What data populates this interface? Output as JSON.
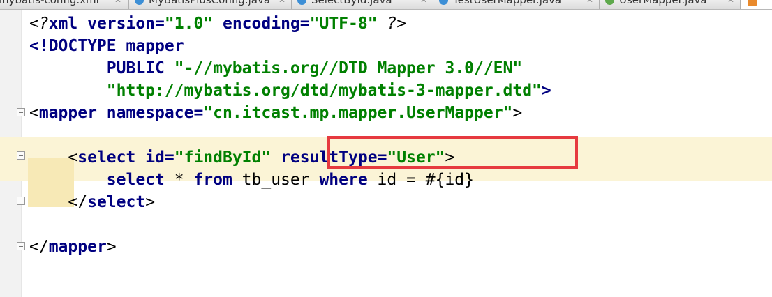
{
  "tabs": [
    {
      "label": "mybatis-config.xml",
      "icon": "xml-file-icon",
      "icon_color": "#e98a2c"
    },
    {
      "label": "MyBatisPlusConfig.java",
      "icon": "java-class-icon",
      "icon_color": "#3d8fd6"
    },
    {
      "label": "SelectById.java",
      "icon": "java-class-icon",
      "icon_color": "#3d8fd6"
    },
    {
      "label": "TestUserMapper.java",
      "icon": "java-class-icon",
      "icon_color": "#3d8fd6"
    },
    {
      "label": "UserMapper.java",
      "icon": "java-interface-icon",
      "icon_color": "#5ea94c"
    },
    {
      "label": "",
      "icon": "xml-file-icon",
      "icon_color": "#e98a2c"
    }
  ],
  "code": {
    "line1": {
      "a": "<?",
      "b": "xml",
      "c": " version",
      "d": "=",
      "e": "\"1.0\"",
      "f": " encoding",
      "g": "=",
      "h": "\"UTF-8\"",
      "i": " ?>"
    },
    "line2": {
      "a": "<!DOCTYPE ",
      "b": "mapper"
    },
    "line3": {
      "a": "        PUBLIC ",
      "b": "\"-//mybatis.org//DTD Mapper 3.0//EN\""
    },
    "line4": {
      "a": "        ",
      "b": "\"http://mybatis.org/dtd/mybatis-3-mapper.dtd\"",
      "c": ">"
    },
    "line5": {
      "a": "<",
      "b": "mapper",
      "c": " namespace",
      "d": "=",
      "e": "\"cn.itcast.mp.mapper.UserMapper\"",
      "f": ">"
    },
    "line7": {
      "a": "    <",
      "b": "select",
      "c": " id",
      "d": "=",
      "e": "\"findById\"",
      "f": " resultType",
      "g": "=",
      "h": "\"User\"",
      "i": ">"
    },
    "line8": {
      "a": "        ",
      "b": "select",
      "c": " * ",
      "d": "from",
      "e": " tb_user ",
      "f": "where",
      "g": " id = #{id}"
    },
    "line9": {
      "a": "    </",
      "b": "select",
      "c": ">"
    },
    "line11": {
      "a": "</",
      "b": "mapper",
      "c": ">"
    }
  },
  "highlight": {
    "annotation_color": "#e63a3f"
  }
}
